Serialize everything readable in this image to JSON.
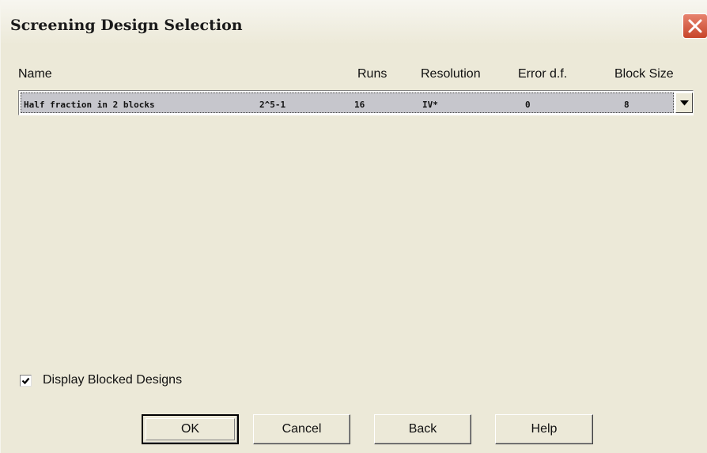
{
  "window": {
    "title": "Screening Design Selection"
  },
  "columns": [
    "Name",
    "Runs",
    "Resolution",
    "Error d.f.",
    "Block Size"
  ],
  "design_row": {
    "name": "Half fraction in 2 blocks",
    "design": "2^5-1",
    "runs": "16",
    "resolution": "IV*",
    "error_df": "0",
    "block_size": "8"
  },
  "options": {
    "display_blocked_label": "Display Blocked Designs",
    "display_blocked_checked": true
  },
  "buttons": {
    "ok": "OK",
    "cancel": "Cancel",
    "back": "Back",
    "help": "Help"
  },
  "icons": {
    "close": "close-icon",
    "dropdown": "chevron-down-icon",
    "check": "checkmark-icon"
  }
}
